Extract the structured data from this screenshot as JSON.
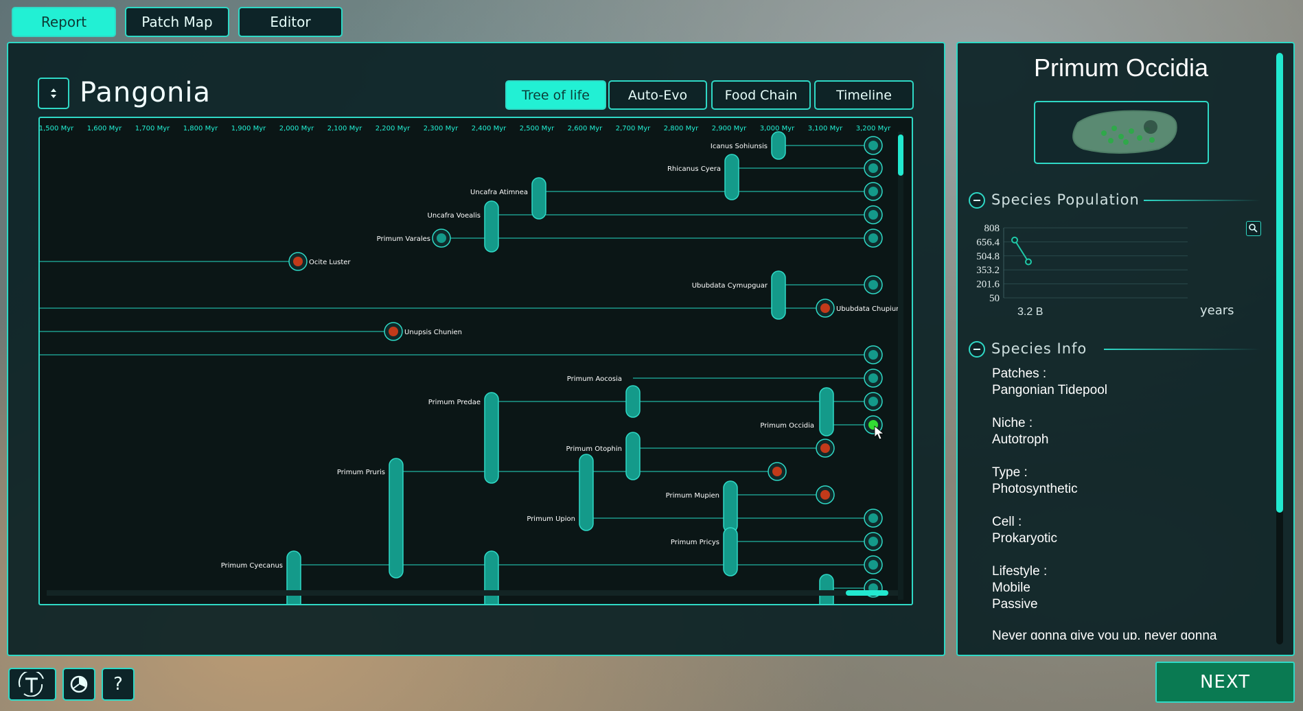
{
  "nav": {
    "report": "Report",
    "patch_map": "Patch Map",
    "editor": "Editor"
  },
  "patch": {
    "name": "Pangonia"
  },
  "tabs": {
    "tree": "Tree of life",
    "autoevo": "Auto-Evo",
    "food": "Food Chain",
    "timeline": "Timeline"
  },
  "timeline_labels": [
    "1,500 Myr",
    "1,600 Myr",
    "1,700 Myr",
    "1,800 Myr",
    "1,900 Myr",
    "2,000 Myr",
    "2,100 Myr",
    "2,200 Myr",
    "2,300 Myr",
    "2,400 Myr",
    "2,500 Myr",
    "2,600 Myr",
    "2,700 Myr",
    "2,800 Myr",
    "2,900 Myr",
    "3,000 Myr",
    "3,100 Myr",
    "3,200 Myr"
  ],
  "species_labels": {
    "icanus": "Icanus Sohiunsis",
    "rhicanus": "Rhicanus Cyera",
    "uncafra_a": "Uncafra Atimnea",
    "uncafra_v": "Uncafra Voealis",
    "primum_varales": "Primum Varales",
    "ocite": "Ocite Luster",
    "ububdata_c": "Ububdata Cymupguar",
    "ububdata_ch": "Ububdata Chupiun",
    "unupsis": "Unupsis Chunien",
    "aocosia": "Primum Aocosia",
    "predae": "Primum Predae",
    "occidia": "Primum Occidia",
    "otophin": "Primum Otophin",
    "pruris": "Primum Pruris",
    "mupien": "Primum Mupien",
    "upion": "Primum Upion",
    "pricys": "Primum Pricys",
    "cyecanus": "Primum Cyecanus"
  },
  "species_panel": {
    "name": "Primum Occidia",
    "population_title": "Species Population",
    "info_title": "Species Info",
    "chart_x_label": "3.2 B",
    "chart_x_unit": "years",
    "patches_label": "Patches :",
    "patches_value": "Pangonian Tidepool",
    "niche_label": "Niche :",
    "niche_value": "Autotroph",
    "type_label": "Type :",
    "type_value": "Photosynthetic",
    "cell_label": "Cell :",
    "cell_value": "Prokaryotic",
    "lifestyle_label": "Lifestyle :",
    "lifestyle_value1": "Mobile",
    "lifestyle_value2": "Passive",
    "description": "Never gonna give you up, never gonna"
  },
  "chart_data": {
    "type": "line",
    "yticks": [
      "808",
      "656.4",
      "504.8",
      "353.2",
      "201.6",
      "50"
    ],
    "ylim": [
      50,
      808
    ],
    "series": [
      {
        "values": [
          676,
          440
        ]
      }
    ],
    "xlabel": "years"
  },
  "bottom": {
    "help": "?",
    "next": "NEXT"
  },
  "colors": {
    "accent": "#2fd9c6",
    "active": "#22f0d4",
    "node": "#149a8a",
    "extinct": "#c23a1a",
    "selected": "#33dd33",
    "next": "#0a7a52"
  }
}
